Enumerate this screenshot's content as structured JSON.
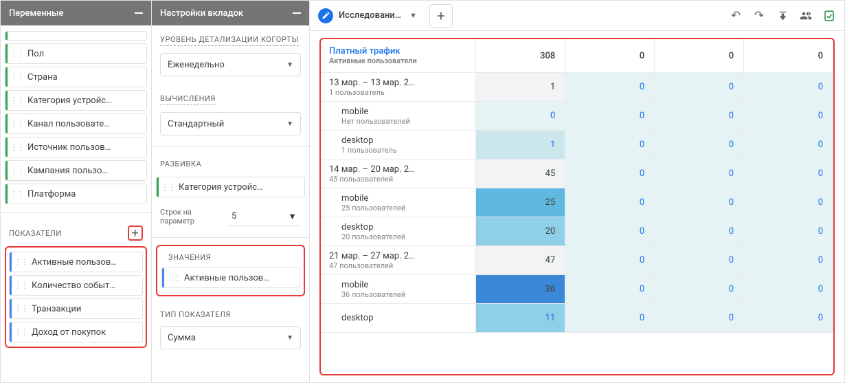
{
  "panels": {
    "variables": {
      "title": "Переменные",
      "dims": [
        "Пол",
        "Страна",
        "Категория устройс…",
        "Канал пользовате…",
        "Источник пользов…",
        "Кампания пользо…",
        "Платформа"
      ],
      "metrics_title": "ПОКАЗАТЕЛИ",
      "metrics": [
        "Активные пользов…",
        "Количество событ…",
        "Транзакции",
        "Доход от покупок"
      ]
    },
    "settings": {
      "title": "Настройки вкладок",
      "cohort_level_label": "УРОВЕНЬ ДЕТАЛИЗАЦИИ КОГОРТЫ",
      "cohort_level_value": "Еженедельно",
      "calc_label": "ВЫЧИСЛЕНИЯ",
      "calc_value": "Стандартный",
      "breakdown_label": "РАЗБИВКА",
      "breakdown_chip": "Категория устройс…",
      "rows_per_label": "Строк на параметр",
      "rows_per_value": "5",
      "values_label": "ЗНАЧЕНИЯ",
      "values_chip": "Активные пользов…",
      "metric_type_label": "ТИП ПОКАЗАТЕЛЯ",
      "metric_type_value": "Сумма"
    }
  },
  "tab": {
    "name": "Исследовани…"
  },
  "table": {
    "header_title": "Платный трафик",
    "header_sub": "Активные пользователи",
    "totals": [
      "308",
      "0",
      "0",
      "0"
    ],
    "rows": [
      {
        "label": "13 мар. – 13 мар. 2…",
        "sub": "1 пользователь",
        "indent": 0,
        "cells": [
          {
            "v": "1",
            "cls": "grey"
          },
          {
            "v": "0",
            "cls": "h0 zero"
          },
          {
            "v": "0",
            "cls": "h0 zero"
          },
          {
            "v": "0",
            "cls": "h0 zero"
          }
        ]
      },
      {
        "label": "mobile",
        "sub": "Нет пользователей",
        "indent": 1,
        "cells": [
          {
            "v": "0",
            "cls": "h0 zero"
          },
          {
            "v": "0",
            "cls": "h0 zero"
          },
          {
            "v": "0",
            "cls": "h0 zero"
          },
          {
            "v": "0",
            "cls": "h0 zero"
          }
        ]
      },
      {
        "label": "desktop",
        "sub": "1 пользователь",
        "indent": 1,
        "cells": [
          {
            "v": "1",
            "cls": "h1 zero"
          },
          {
            "v": "0",
            "cls": "h0 zero"
          },
          {
            "v": "0",
            "cls": "h0 zero"
          },
          {
            "v": "0",
            "cls": "h0 zero"
          }
        ]
      },
      {
        "label": "14 мар. – 20 мар. 2…",
        "sub": "45 пользователей",
        "indent": 0,
        "cells": [
          {
            "v": "45",
            "cls": "grey"
          },
          {
            "v": "0",
            "cls": "h0 zero"
          },
          {
            "v": "0",
            "cls": "h0 zero"
          },
          {
            "v": "0",
            "cls": "h0 zero"
          }
        ]
      },
      {
        "label": "mobile",
        "sub": "25 пользователей",
        "indent": 1,
        "cells": [
          {
            "v": "25",
            "cls": "h3"
          },
          {
            "v": "0",
            "cls": "h0 zero"
          },
          {
            "v": "0",
            "cls": "h0 zero"
          },
          {
            "v": "0",
            "cls": "h0 zero"
          }
        ]
      },
      {
        "label": "desktop",
        "sub": "20 пользователей",
        "indent": 1,
        "cells": [
          {
            "v": "20",
            "cls": "h2"
          },
          {
            "v": "0",
            "cls": "h0 zero"
          },
          {
            "v": "0",
            "cls": "h0 zero"
          },
          {
            "v": "0",
            "cls": "h0 zero"
          }
        ]
      },
      {
        "label": "21 мар. – 27 мар. 2…",
        "sub": "47 пользователей",
        "indent": 0,
        "cells": [
          {
            "v": "47",
            "cls": "grey"
          },
          {
            "v": "0",
            "cls": "h0 zero"
          },
          {
            "v": "0",
            "cls": "h0 zero"
          },
          {
            "v": "0",
            "cls": "h0 zero"
          }
        ]
      },
      {
        "label": "mobile",
        "sub": "36 пользователей",
        "indent": 1,
        "cells": [
          {
            "v": "36",
            "cls": "h4"
          },
          {
            "v": "0",
            "cls": "h0 zero"
          },
          {
            "v": "0",
            "cls": "h0 zero"
          },
          {
            "v": "0",
            "cls": "h0 zero"
          }
        ]
      },
      {
        "label": "desktop",
        "sub": "",
        "indent": 1,
        "cells": [
          {
            "v": "11",
            "cls": "h2 zero"
          },
          {
            "v": "0",
            "cls": "h0 zero"
          },
          {
            "v": "0",
            "cls": "h0 zero"
          },
          {
            "v": "0",
            "cls": "h0 zero"
          }
        ]
      }
    ]
  }
}
